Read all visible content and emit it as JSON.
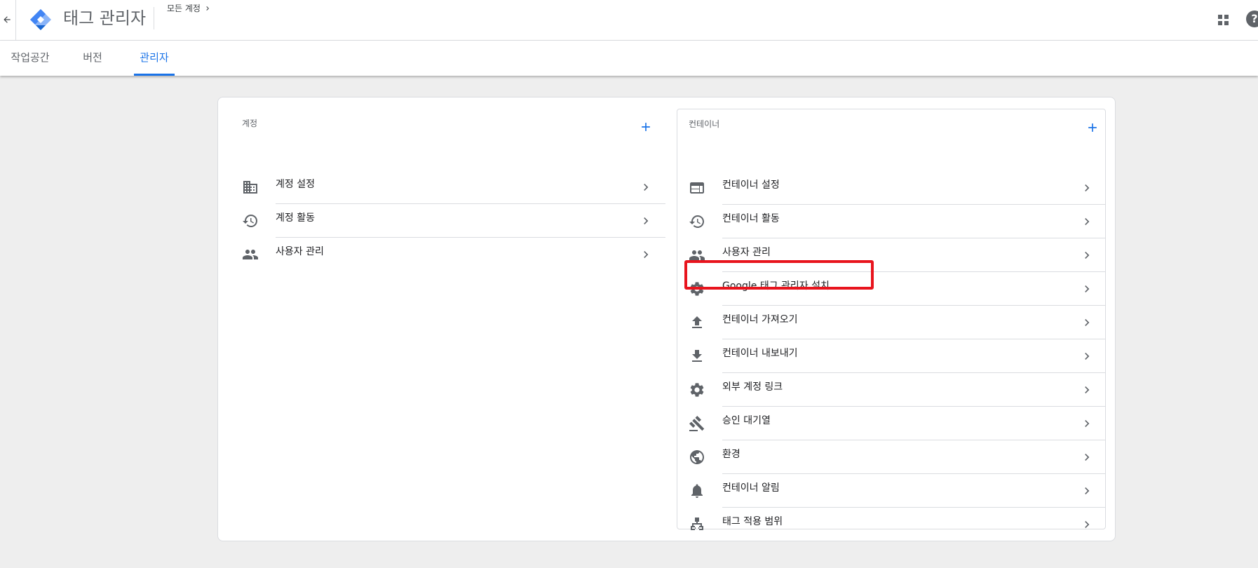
{
  "header": {
    "app_title": "태그 관리자",
    "breadcrumb": "모든 계정"
  },
  "tabs": [
    {
      "label": "작업공간",
      "active": false
    },
    {
      "label": "버전",
      "active": false
    },
    {
      "label": "관리자",
      "active": true
    }
  ],
  "account": {
    "label": "계정",
    "items": [
      {
        "label": "계정 설정",
        "icon": "building-icon"
      },
      {
        "label": "계정 활동",
        "icon": "history-icon"
      },
      {
        "label": "사용자 관리",
        "icon": "people-icon"
      }
    ]
  },
  "container": {
    "label": "컨테이너",
    "items": [
      {
        "label": "컨테이너 설정",
        "icon": "web-window-icon"
      },
      {
        "label": "컨테이너 활동",
        "icon": "history-icon"
      },
      {
        "label": "사용자 관리",
        "icon": "people-icon"
      },
      {
        "label": "Google 태그 관리자 설치",
        "icon": "gear-icon"
      },
      {
        "label": "컨테이너 가져오기",
        "icon": "upload-icon"
      },
      {
        "label": "컨테이너 내보내기",
        "icon": "download-icon"
      },
      {
        "label": "외부 계정 링크",
        "icon": "gear-icon"
      },
      {
        "label": "승인 대기열",
        "icon": "gavel-icon"
      },
      {
        "label": "환경",
        "icon": "globe-icon"
      },
      {
        "label": "컨테이너 알림",
        "icon": "bell-icon"
      },
      {
        "label": "태그 적용 범위",
        "icon": "sitemap-icon"
      }
    ]
  },
  "colors": {
    "accent": "#1a73e8",
    "highlight": "#e8141d",
    "icon": "#5f6368"
  }
}
